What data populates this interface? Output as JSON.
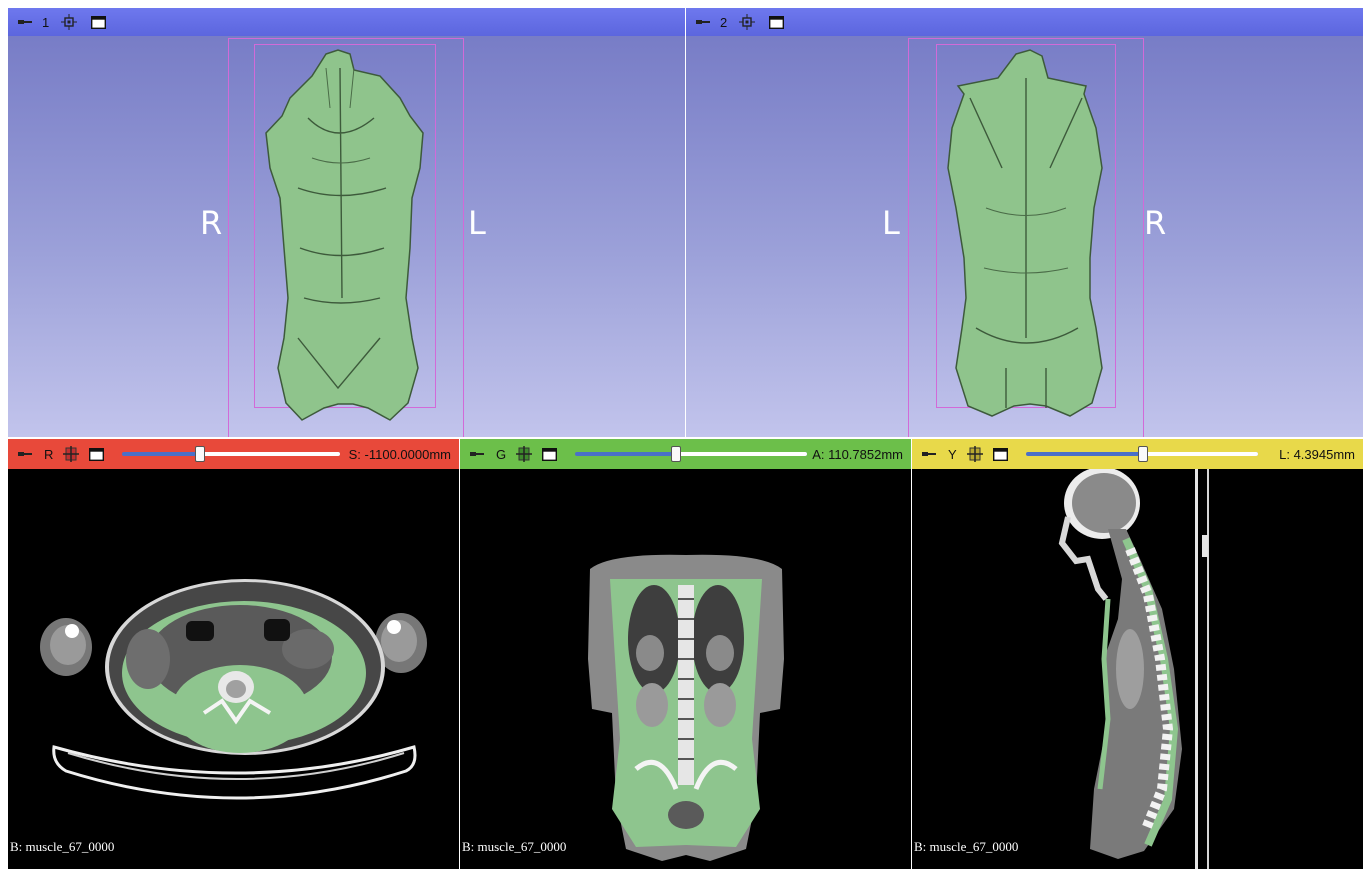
{
  "views3d": [
    {
      "number": "1",
      "left_label": "R",
      "right_label": "L"
    },
    {
      "number": "2",
      "left_label": "L",
      "right_label": "R"
    }
  ],
  "slices": [
    {
      "id": "red",
      "letter": "R",
      "value": "S: -1100.0000mm",
      "slider_fraction": 0.35,
      "corner": "B: muscle_67_0000"
    },
    {
      "id": "green",
      "letter": "G",
      "value": "A: 110.7852mm",
      "slider_fraction": 0.43,
      "corner": "B: muscle_67_0000"
    },
    {
      "id": "yellow",
      "letter": "Y",
      "value": "L: 4.3945mm",
      "slider_fraction": 0.5,
      "corner": "B: muscle_67_0000"
    }
  ],
  "icons": {
    "pin": "pin-icon",
    "center": "center-view-icon",
    "link": "link-icon",
    "window": "maximize-window-icon"
  },
  "colors": {
    "view_bar_3d": "#6e78ee",
    "red_bar": "#e8493a",
    "green_bar": "#6cbf4a",
    "yellow_bar": "#e8d94a",
    "segmentation": "#8ec58e"
  }
}
